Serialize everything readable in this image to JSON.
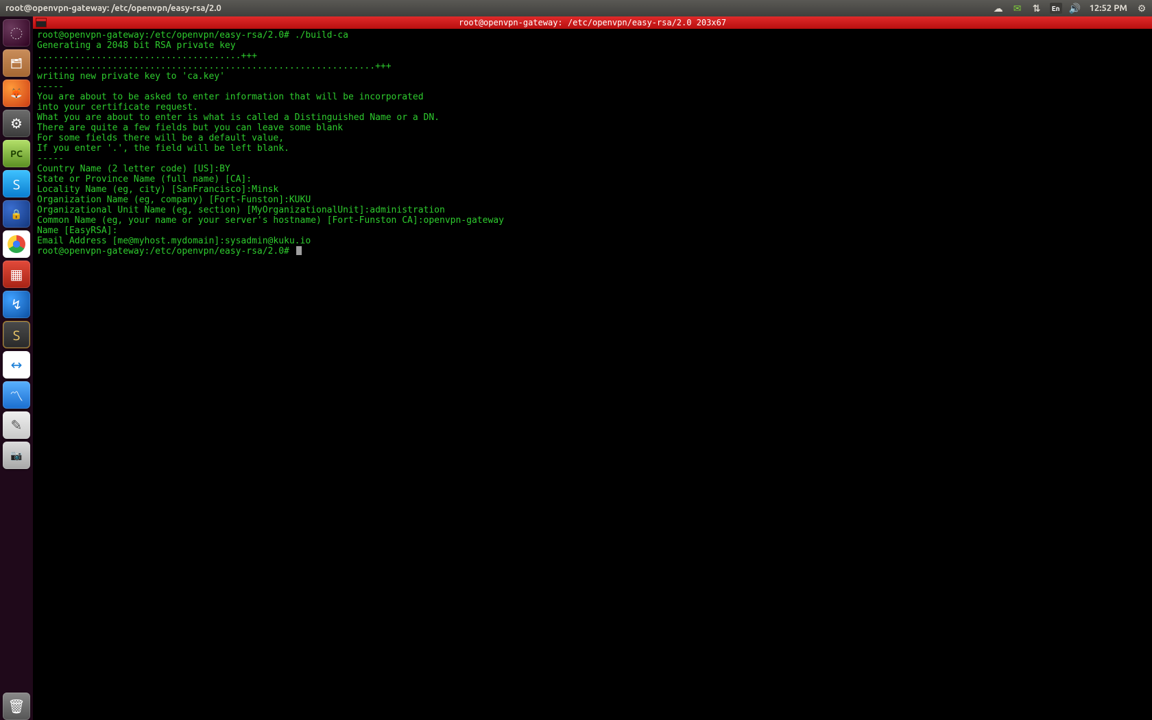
{
  "menubar": {
    "title": "root@openvpn-gateway: /etc/openvpn/easy-rsa/2.0",
    "lang": "En",
    "clock": "12:52 PM"
  },
  "launcher": {
    "items": [
      {
        "name": "dash-home",
        "glyph": "◌",
        "class": "tile-dash"
      },
      {
        "name": "files",
        "glyph": "🗂",
        "class": "tile-files"
      },
      {
        "name": "firefox",
        "glyph": "🦊",
        "class": "tile-firefox"
      },
      {
        "name": "settings",
        "glyph": "⚙",
        "class": "tile-gear"
      },
      {
        "name": "pycharm",
        "glyph": "PC",
        "class": "tile-pycharm"
      },
      {
        "name": "skype",
        "glyph": "S",
        "class": "tile-skype"
      },
      {
        "name": "keyring",
        "glyph": "🔒",
        "class": "tile-lock"
      },
      {
        "name": "chrome",
        "glyph": "",
        "class": "tile-chrome"
      },
      {
        "name": "app-red",
        "glyph": "▦",
        "class": "tile-red"
      },
      {
        "name": "bittorrent",
        "glyph": "↯",
        "class": "tile-bt"
      },
      {
        "name": "sublime-text",
        "glyph": "S",
        "class": "tile-st"
      },
      {
        "name": "teamviewer",
        "glyph": "↔",
        "class": "tile-tv"
      },
      {
        "name": "system-monitor",
        "glyph": "〽",
        "class": "tile-monitor"
      },
      {
        "name": "text-editor",
        "glyph": "✎",
        "class": "tile-note"
      },
      {
        "name": "screenshot",
        "glyph": "📷",
        "class": "tile-camera"
      }
    ],
    "trash": {
      "name": "trash",
      "glyph": "🗑",
      "class": "tile-trash"
    }
  },
  "terminal": {
    "titlebar": "root@openvpn-gateway: /etc/openvpn/easy-rsa/2.0 203x67",
    "prompt": "root@openvpn-gateway:/etc/openvpn/easy-rsa/2.0#",
    "command": "./build-ca",
    "lines": [
      "Generating a 2048 bit RSA private key",
      "......................................+++",
      "...............................................................+++",
      "writing new private key to 'ca.key'",
      "-----",
      "You are about to be asked to enter information that will be incorporated",
      "into your certificate request.",
      "What you are about to enter is what is called a Distinguished Name or a DN.",
      "There are quite a few fields but you can leave some blank",
      "For some fields there will be a default value,",
      "If you enter '.', the field will be left blank.",
      "-----",
      "Country Name (2 letter code) [US]:BY",
      "State or Province Name (full name) [CA]:",
      "Locality Name (eg, city) [SanFrancisco]:Minsk",
      "Organization Name (eg, company) [Fort-Funston]:KUKU",
      "Organizational Unit Name (eg, section) [MyOrganizationalUnit]:administration",
      "Common Name (eg, your name or your server's hostname) [Fort-Funston CA]:openvpn-gateway",
      "Name [EasyRSA]:",
      "Email Address [me@myhost.mydomain]:sysadmin@kuku.io"
    ]
  }
}
